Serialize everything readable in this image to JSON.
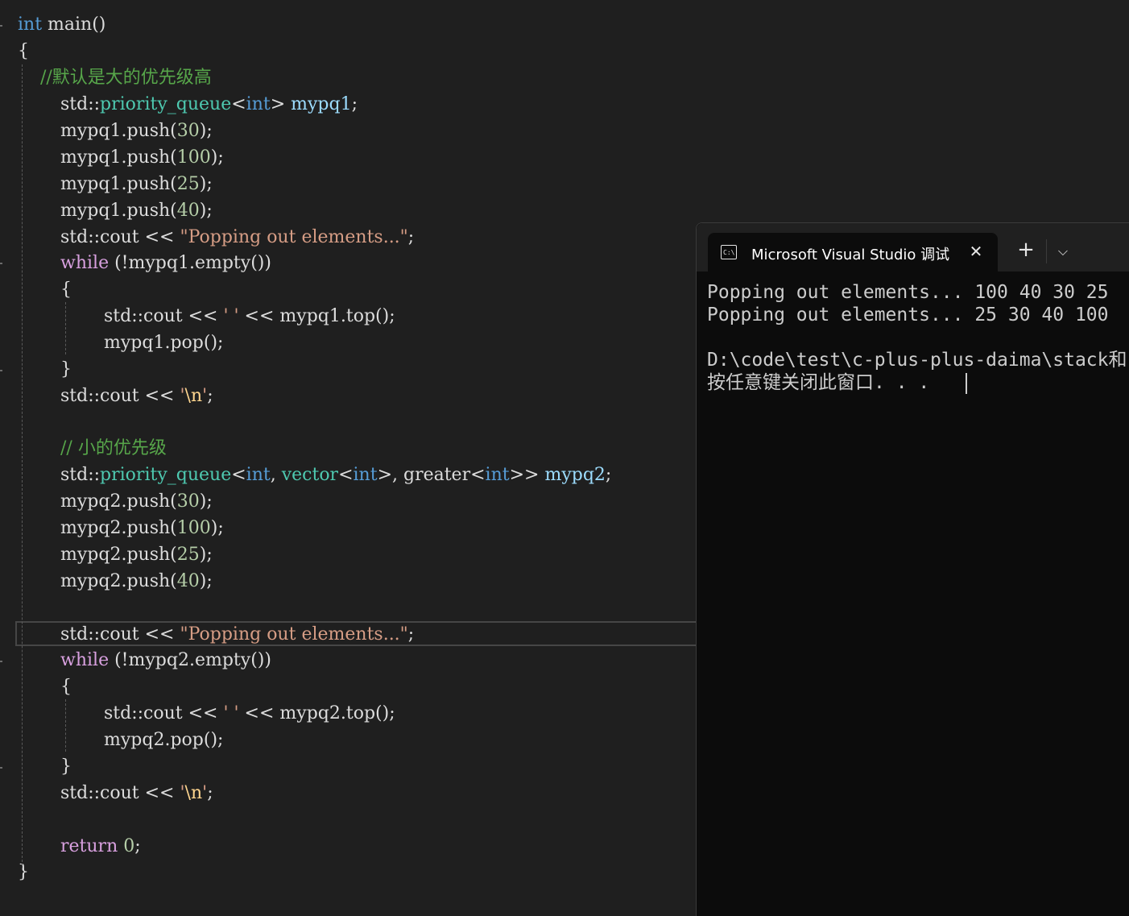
{
  "editor": {
    "lines": [
      [
        {
          "t": "int",
          "c": "kw"
        },
        {
          "t": " main()",
          "c": "plain"
        }
      ],
      [
        {
          "t": "{",
          "c": "plain"
        }
      ],
      [
        {
          "t": "    //默认是大的优先级高",
          "c": "cmt"
        }
      ],
      [
        {
          "t": "std::",
          "c": "plain"
        },
        {
          "t": "priority_queue",
          "c": "type"
        },
        {
          "t": "<",
          "c": "plain"
        },
        {
          "t": "int",
          "c": "kw"
        },
        {
          "t": "> ",
          "c": "plain"
        },
        {
          "t": "mypq1",
          "c": "var"
        },
        {
          "t": ";",
          "c": "plain"
        }
      ],
      [
        {
          "t": "mypq1.push(",
          "c": "plain"
        },
        {
          "t": "30",
          "c": "num"
        },
        {
          "t": ");",
          "c": "plain"
        }
      ],
      [
        {
          "t": "mypq1.push(",
          "c": "plain"
        },
        {
          "t": "100",
          "c": "num"
        },
        {
          "t": ");",
          "c": "plain"
        }
      ],
      [
        {
          "t": "mypq1.push(",
          "c": "plain"
        },
        {
          "t": "25",
          "c": "num"
        },
        {
          "t": ");",
          "c": "plain"
        }
      ],
      [
        {
          "t": "mypq1.push(",
          "c": "plain"
        },
        {
          "t": "40",
          "c": "num"
        },
        {
          "t": ");",
          "c": "plain"
        }
      ],
      [
        {
          "t": "std::cout << ",
          "c": "plain"
        },
        {
          "t": "\"Popping out elements...\"",
          "c": "str"
        },
        {
          "t": ";",
          "c": "plain"
        }
      ],
      [
        {
          "t": "while",
          "c": "ctl"
        },
        {
          "t": " (!mypq1.empty())",
          "c": "plain"
        }
      ],
      [
        {
          "t": "{",
          "c": "plain"
        }
      ],
      [
        {
          "t": "std::cout << ",
          "c": "plain"
        },
        {
          "t": "' '",
          "c": "str"
        },
        {
          "t": " << mypq1.top();",
          "c": "plain"
        }
      ],
      [
        {
          "t": "mypq1.pop();",
          "c": "plain"
        }
      ],
      [
        {
          "t": "}",
          "c": "plain"
        }
      ],
      [
        {
          "t": "std::cout << ",
          "c": "plain"
        },
        {
          "t": "'",
          "c": "str"
        },
        {
          "t": "\\n",
          "c": "esc"
        },
        {
          "t": "'",
          "c": "str"
        },
        {
          "t": ";",
          "c": "plain"
        }
      ],
      [],
      [
        {
          "t": "// 小的优先级",
          "c": "cmt"
        }
      ],
      [
        {
          "t": "std::",
          "c": "plain"
        },
        {
          "t": "priority_queue",
          "c": "type"
        },
        {
          "t": "<",
          "c": "plain"
        },
        {
          "t": "int",
          "c": "kw"
        },
        {
          "t": ", ",
          "c": "plain"
        },
        {
          "t": "vector",
          "c": "type"
        },
        {
          "t": "<",
          "c": "plain"
        },
        {
          "t": "int",
          "c": "kw"
        },
        {
          "t": ">, greater<",
          "c": "plain"
        },
        {
          "t": "int",
          "c": "kw"
        },
        {
          "t": ">> ",
          "c": "plain"
        },
        {
          "t": "mypq2",
          "c": "var"
        },
        {
          "t": ";",
          "c": "plain"
        }
      ],
      [
        {
          "t": "mypq2.push(",
          "c": "plain"
        },
        {
          "t": "30",
          "c": "num"
        },
        {
          "t": ");",
          "c": "plain"
        }
      ],
      [
        {
          "t": "mypq2.push(",
          "c": "plain"
        },
        {
          "t": "100",
          "c": "num"
        },
        {
          "t": ");",
          "c": "plain"
        }
      ],
      [
        {
          "t": "mypq2.push(",
          "c": "plain"
        },
        {
          "t": "25",
          "c": "num"
        },
        {
          "t": ");",
          "c": "plain"
        }
      ],
      [
        {
          "t": "mypq2.push(",
          "c": "plain"
        },
        {
          "t": "40",
          "c": "num"
        },
        {
          "t": ");",
          "c": "plain"
        }
      ],
      [],
      [
        {
          "t": "std::cout << ",
          "c": "plain"
        },
        {
          "t": "\"Popping out elements...\"",
          "c": "str"
        },
        {
          "t": ";",
          "c": "plain"
        }
      ],
      [
        {
          "t": "while",
          "c": "ctl"
        },
        {
          "t": " (!mypq2.empty())",
          "c": "plain"
        }
      ],
      [
        {
          "t": "{",
          "c": "plain"
        }
      ],
      [
        {
          "t": "std::cout << ",
          "c": "plain"
        },
        {
          "t": "' '",
          "c": "str"
        },
        {
          "t": " << mypq2.top();",
          "c": "plain"
        }
      ],
      [
        {
          "t": "mypq2.pop();",
          "c": "plain"
        }
      ],
      [
        {
          "t": "}",
          "c": "plain"
        }
      ],
      [
        {
          "t": "std::cout << ",
          "c": "plain"
        },
        {
          "t": "'",
          "c": "str"
        },
        {
          "t": "\\n",
          "c": "esc"
        },
        {
          "t": "'",
          "c": "str"
        },
        {
          "t": ";",
          "c": "plain"
        }
      ],
      [],
      [
        {
          "t": "return",
          "c": "ctl"
        },
        {
          "t": " ",
          "c": "plain"
        },
        {
          "t": "0",
          "c": "num"
        },
        {
          "t": ";",
          "c": "plain"
        }
      ],
      [
        {
          "t": "}",
          "c": "plain"
        }
      ]
    ]
  },
  "terminal": {
    "tab_icon": "console-icon",
    "tab_icon_text": "C:\\",
    "tab_title": "Microsoft Visual Studio 调试控",
    "close_glyph": "✕",
    "new_tab_glyph": "+",
    "dropdown_glyph": "⌵",
    "output": [
      "Popping out elements... 100 40 30 25",
      "Popping out elements... 25 30 40 100",
      "",
      "D:\\code\\test\\c-plus-plus-daima\\stack和",
      "按任意键关闭此窗口. . ."
    ]
  }
}
